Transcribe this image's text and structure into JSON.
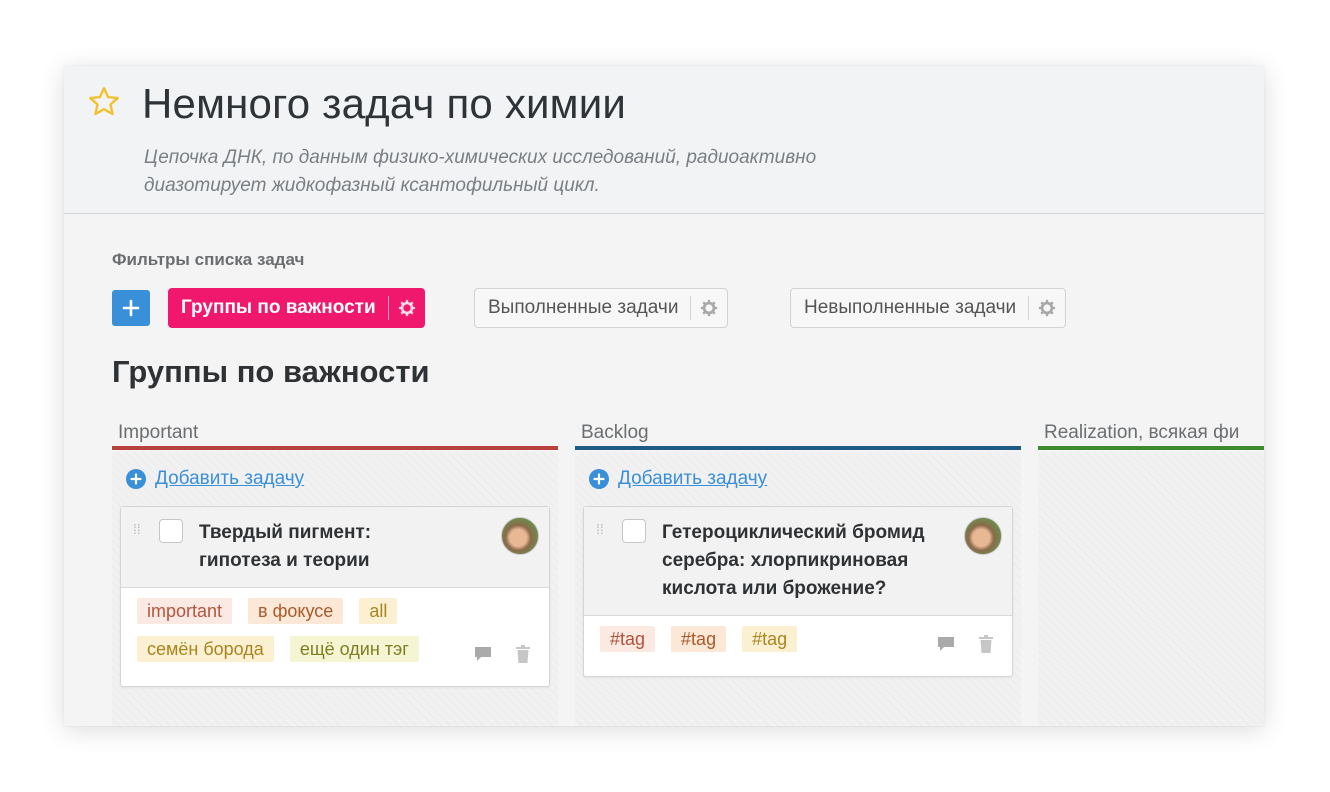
{
  "header": {
    "title": "Немного задач по химии",
    "description_line1": "Цепочка ДНК, по данным физико-химических исследований, радиоактивно",
    "description_line2": "диазотирует жидкофазный ксантофильный цикл.",
    "star_icon": "star-outline-icon",
    "star_color": "#f2c12e"
  },
  "filters": {
    "label": "Фильтры списка задач",
    "add_icon": "plus-icon",
    "items": [
      {
        "label": "Группы по важности",
        "active": true
      },
      {
        "label": "Выполненные задачи",
        "active": false
      },
      {
        "label": "Невыполненные задачи",
        "active": false
      }
    ],
    "active_color": "#f0186d"
  },
  "section": {
    "title": "Группы по важности"
  },
  "columns": [
    {
      "name": "Important",
      "color": "#b8413d",
      "add_task_label": "Добавить задачу",
      "cards": [
        {
          "title_line1": "Твердый пигмент:",
          "title_line2": "гипотеза и теории",
          "tags": [
            "important",
            "в фокусе",
            "all",
            "семён борода",
            "ещё один тэг"
          ]
        }
      ]
    },
    {
      "name": "Backlog",
      "color": "#1f5a86",
      "add_task_label": "Добавить задачу",
      "cards": [
        {
          "title_line1": "Гетероциклический бромид",
          "title_line2": "серебра: хлорпикриновая",
          "title_line3": "кислота или брожение?",
          "tags": [
            "#tag",
            "#tag",
            "#tag"
          ]
        }
      ]
    },
    {
      "name": "Realization, всякая фи",
      "color": "#3d8b2f",
      "cards": []
    }
  ]
}
